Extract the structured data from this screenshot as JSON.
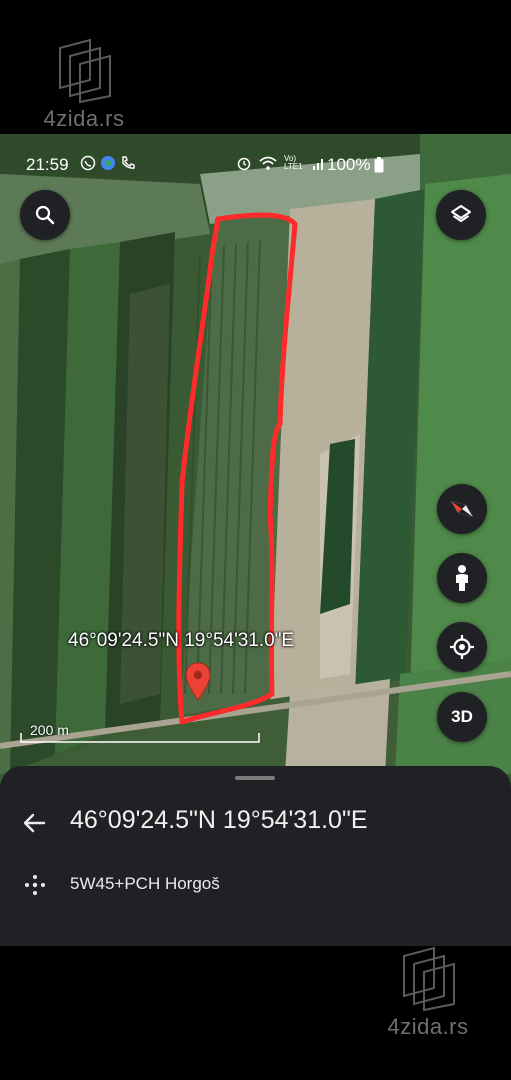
{
  "watermark": {
    "text": "4zida.rs"
  },
  "status_bar": {
    "time": "21:59",
    "battery": "100%",
    "network": "Vo) LTE1"
  },
  "map": {
    "coordinate_label": "46°09'24.5\"N 19°54'31.0\"E",
    "scale_label": "200 m",
    "controls": {
      "search": "search-icon",
      "layers": "layers-icon",
      "compass": "compass-icon",
      "street_view": "pegman-icon",
      "my_location": "my-location-icon",
      "three_d": "3D"
    },
    "marker_color": "#ea4335",
    "outline_color": "#ff2a2a"
  },
  "place_sheet": {
    "title": "46°09'24.5\"N 19°54'31.0\"E",
    "plus_code": "5W45+PCH Horgoš"
  }
}
